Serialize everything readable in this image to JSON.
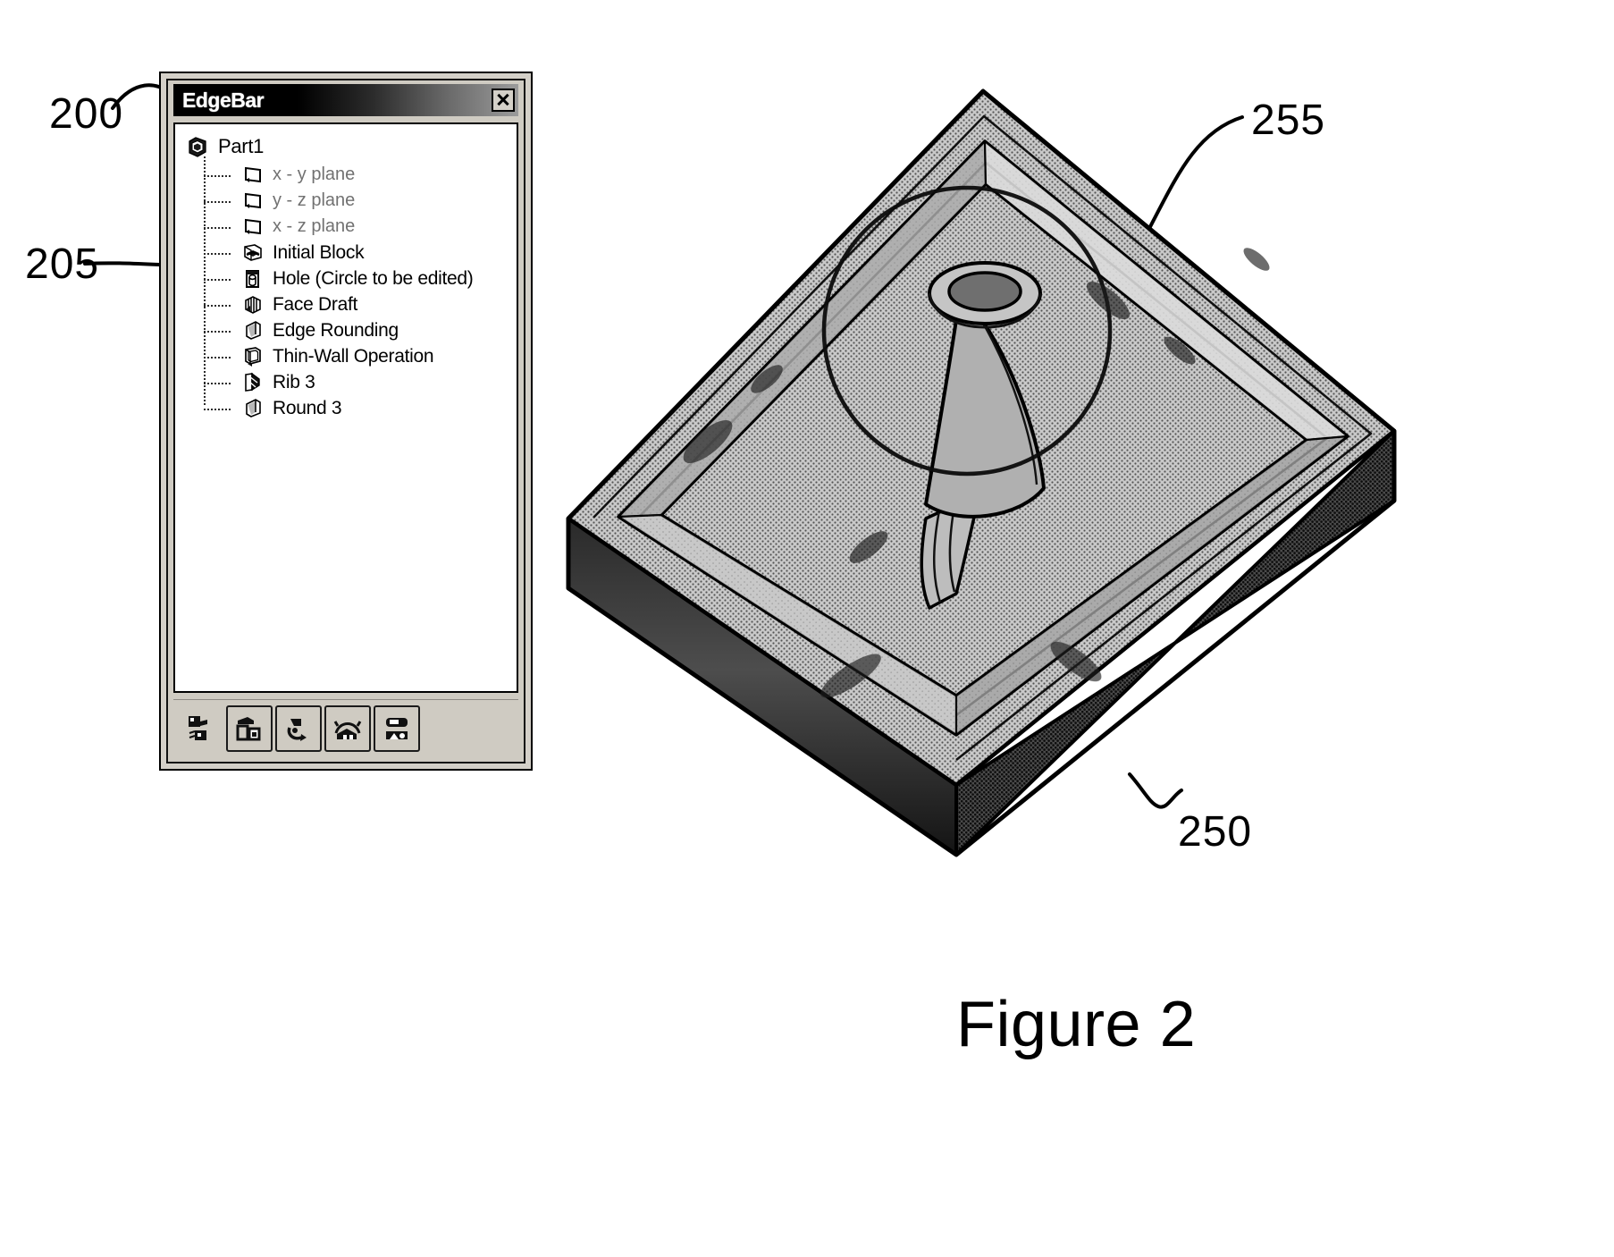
{
  "figure": {
    "caption": "Figure 2",
    "reference_numerals": [
      {
        "id": "200",
        "value": "200",
        "points_to": "edgebar-window-titlebar"
      },
      {
        "id": "205",
        "value": "205",
        "points_to": "tree-item-hole"
      },
      {
        "id": "255",
        "value": "255",
        "points_to": "model-boss-feature"
      },
      {
        "id": "250",
        "value": "250",
        "points_to": "model-part-body"
      }
    ]
  },
  "window": {
    "title": "EdgeBar",
    "close_button_label": "✕",
    "close_icon": "close-icon"
  },
  "tree": {
    "root": {
      "label": "Part1",
      "icon": "part-document-icon"
    },
    "items": [
      {
        "label": "x - y plane",
        "icon": "plane-icon",
        "style": "plane"
      },
      {
        "label": "y - z plane",
        "icon": "plane-icon",
        "style": "plane"
      },
      {
        "label": "x - z plane",
        "icon": "plane-icon",
        "style": "plane"
      },
      {
        "label": "Initial Block",
        "icon": "block-feature-icon",
        "style": "feature"
      },
      {
        "label": "Hole (Circle to be edited)",
        "icon": "hole-feature-icon",
        "style": "feature"
      },
      {
        "label": "Face Draft",
        "icon": "draft-feature-icon",
        "style": "feature"
      },
      {
        "label": "Edge Rounding",
        "icon": "round-feature-icon",
        "style": "feature"
      },
      {
        "label": "Thin-Wall Operation",
        "icon": "thinwall-feature-icon",
        "style": "feature"
      },
      {
        "label": "Rib 3",
        "icon": "rib-feature-icon",
        "style": "feature"
      },
      {
        "label": "Round 3",
        "icon": "round-feature-icon",
        "style": "feature"
      }
    ]
  },
  "toolbar": {
    "buttons": [
      {
        "icon": "select-tool-icon",
        "framed": false
      },
      {
        "icon": "part-copy-tool-icon",
        "framed": true
      },
      {
        "icon": "rotate-tool-icon",
        "framed": true
      },
      {
        "icon": "assembly-tool-icon",
        "framed": true
      },
      {
        "icon": "draw-view-tool-icon",
        "framed": true
      }
    ]
  },
  "model": {
    "name": "thin-wall enclosure part with boss and rib",
    "callouts": {
      "boss_circle": "255",
      "part_body": "250"
    }
  },
  "colors": {
    "ink": "#000000",
    "window_face": "#d4d0c8",
    "tree_background": "#ffffff",
    "titlebar_start": "#000000",
    "titlebar_end": "#9b9b9b",
    "model_shade_light": "#b8b8b8",
    "model_shade_mid": "#8f8f8f",
    "model_shade_dark": "#3a3a3a"
  }
}
